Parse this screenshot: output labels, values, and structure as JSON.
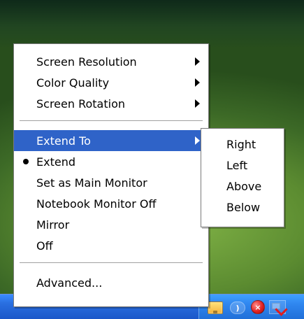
{
  "main_menu": {
    "items": [
      {
        "label": "Screen Resolution"
      },
      {
        "label": "Color Quality"
      },
      {
        "label": "Screen Rotation"
      },
      {
        "label": "Extend To"
      },
      {
        "label": "Extend"
      },
      {
        "label": "Set as Main Monitor"
      },
      {
        "label": "Notebook Monitor Off"
      },
      {
        "label": "Mirror"
      },
      {
        "label": "Off"
      },
      {
        "label": "Advanced..."
      }
    ]
  },
  "extend_to_submenu": {
    "items": [
      {
        "label": "Right"
      },
      {
        "label": "Left"
      },
      {
        "label": "Above"
      },
      {
        "label": "Below"
      }
    ]
  },
  "theme": {
    "menu_background": "#ffffff",
    "highlight_background": "#2f63c8",
    "highlight_text": "#ffffff",
    "separator": "#a0a0a0",
    "taskbar_blue": "#2a6fe0"
  },
  "tray": {
    "icons": [
      "display-icon",
      "wireless-icon",
      "security-shield-icon",
      "network-disconnected-icon"
    ]
  }
}
